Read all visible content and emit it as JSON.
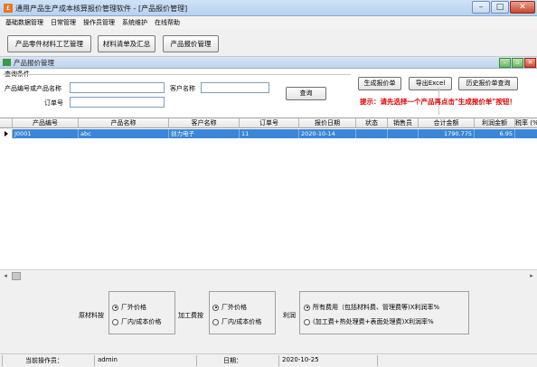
{
  "window": {
    "title": "通用产品生产成本核算报价管理软件 - [产品报价管理]",
    "controls": {
      "minimize": "–",
      "maximize": "□",
      "close": "✕"
    }
  },
  "menu": [
    "基础数据管理",
    "日常管理",
    "操作员管理",
    "系统维护",
    "在线帮助"
  ],
  "toolbar": {
    "btn1": "产品零件材料工艺管理",
    "btn2": "材料清单及汇总",
    "btn3": "产品报价管理"
  },
  "child": {
    "title": "产品报价管理",
    "controls": {
      "minimize": "–",
      "restore": "▫",
      "close": "✕"
    }
  },
  "query": {
    "legend": "查询条件",
    "label_product": "产品编号或产品名称",
    "label_customer": "客户名称",
    "label_order": "订单号",
    "value_product": "",
    "value_customer": "",
    "value_order": "",
    "search_button": "查询"
  },
  "actions": {
    "generate": "生成报价单",
    "export": "导出Excel",
    "history": "历史报价单查询",
    "hint": "提示：请先选择一个产品再点击\"生成报价单\"按钮！"
  },
  "grid": {
    "columns": [
      "产品编号",
      "产品名称",
      "客户名称",
      "订单号",
      "报价日期",
      "状态",
      "销售员",
      "合计金额",
      "利润金额",
      "税率 (%"
    ],
    "rows": [
      [
        "J0001",
        "abc",
        "创力电子",
        "11",
        "2020-10-14",
        "",
        "",
        "1790.775",
        "6.95",
        ""
      ]
    ]
  },
  "options": {
    "material_label": "原材料按",
    "material_opt1": "厂外价格",
    "material_opt2": "厂内/成本价格",
    "process_label": "加工费按",
    "process_opt1": "厂外价格",
    "process_opt2": "厂内/成本价格",
    "profit_label": "利润",
    "profit_opt1": "所有费用（包括材料费、管理费等)X利润率%",
    "profit_opt2": "(加工费+热处理费+表面处理费)X利润率%"
  },
  "status": {
    "operator_label": "当前操作员：",
    "operator": "admin",
    "date_label": "日期：",
    "date": "2020-10-25"
  }
}
